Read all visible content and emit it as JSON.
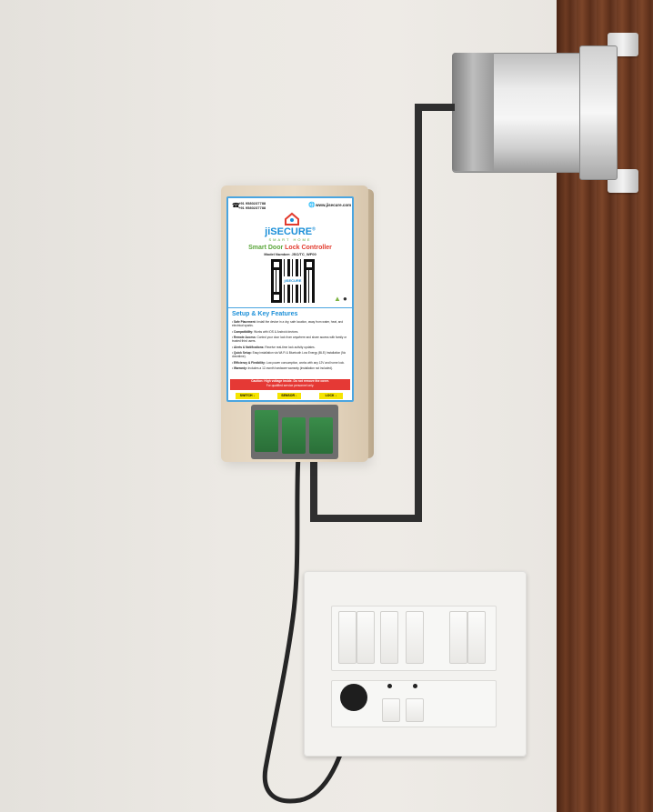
{
  "label": {
    "phone_1": "+91 9580237788",
    "phone_2": "+91 9580237788",
    "website": "www.jisecure.com",
    "brand": "jiSECURE",
    "brand_sup": "®",
    "brand_sub": "SMART HOME",
    "product_title_part1": "Smart Door ",
    "product_title_part2": "Lock Controller",
    "model": "Model Number: JSC/TC_WF00",
    "qr_center": "jiSECURE",
    "features_title": "Setup & Key Features",
    "features": [
      {
        "head": "Safe Placement:",
        "text": "Install the device in a dry, safe location, away from water, heat, and electrical sparks."
      },
      {
        "head": "Compatibility:",
        "text": "Works with iOS & Android devices."
      },
      {
        "head": "Remote Access:",
        "text": "Control your door lock from anywhere and share access with family or trusted third users."
      },
      {
        "head": "Alerts & Notifications:",
        "text": "Receive real-time lock activity updates."
      },
      {
        "head": "Quick Setup:",
        "text": "Easy installation via Wi-Fi & Bluetooth Low Energy (BLE) Installation (No downtime)."
      },
      {
        "head": "Efficiency & Flexibility:",
        "text": "Low power consumption, works with any 12V and home lock."
      },
      {
        "head": "Warranty:",
        "text": "Includes a 12-month hardware warranty (installation not included)."
      }
    ],
    "caution_1": "Caution: High voltage inside. Do not remove the cover.",
    "caution_2": "For qualified service personnel only.",
    "buttons": [
      "SWITCH ↓",
      "SENSOR ↓",
      "LOCK ↓"
    ]
  },
  "colors": {
    "label_border": "#4aa5e0",
    "brand_blue": "#1b8fd8",
    "title_green": "#5aa63a",
    "title_red": "#e23b2e",
    "caution_red": "#e53935",
    "button_yellow": "#f5e400",
    "cable": "#2b2b2b",
    "door_frame": "#6b3a22"
  },
  "icons": [
    "phone-icon",
    "globe-icon",
    "house-logo-icon",
    "android-icon",
    "apple-icon",
    "qr-code"
  ]
}
